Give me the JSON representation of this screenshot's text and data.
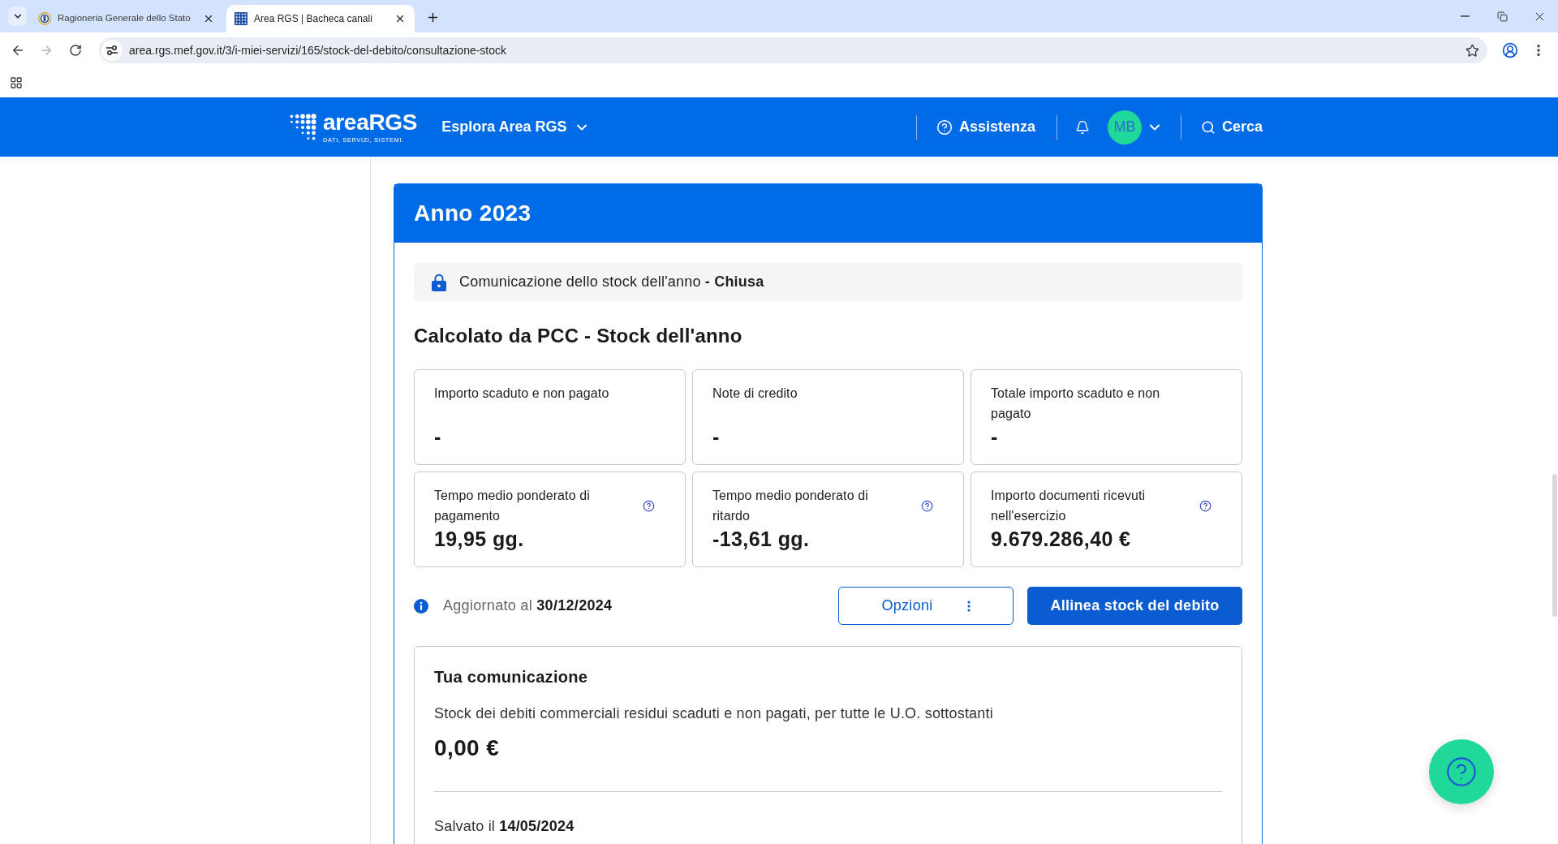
{
  "browser": {
    "tabs": [
      {
        "title": "Ragioneria Generale dello Stato",
        "selected": false
      },
      {
        "title": "Area RGS | Bacheca canali",
        "selected": true
      }
    ],
    "back_disabled": false,
    "forward_disabled": true,
    "url": "area.rgs.mef.gov.it/3/i-miei-servizi/165/stock-del-debito/consultazione-stock"
  },
  "header": {
    "brand": {
      "name": "areaRGS",
      "tagline": "DATI, SERVIZI, SISTEMI."
    },
    "menu": "Esplora Area RGS",
    "help": "Assistenza",
    "user": {
      "initials": "MB"
    },
    "search": "Cerca"
  },
  "card": {
    "title": "Anno 2023",
    "status": "Comunicazione dello stock dell'anno **- Chiusa**",
    "section_title": "Calcolato da PCC - Stock dell'anno",
    "stats": [
      {
        "label": "Importo scaduto e non pagato",
        "value": "-",
        "help": false
      },
      {
        "label": "Note di credito",
        "value": "-",
        "help": false
      },
      {
        "label": "Totale importo scaduto e non pagato",
        "value": "-",
        "help": false
      },
      {
        "label": "Tempo medio ponderato di pagamento",
        "value": "19,95 gg.",
        "help": true
      },
      {
        "label": "Tempo medio ponderato di ritardo",
        "value": "-13,61 gg.",
        "help": true
      },
      {
        "label": "Importo documenti ricevuti nell'esercizio",
        "value": "9.679.286,40 €",
        "help": true
      }
    ],
    "updated": "Aggiornato al **30/12/2024**",
    "buttons": [
      {
        "kind": "outline",
        "label": "Opzioni"
      },
      {
        "kind": "primary",
        "label": "Allinea stock del debito"
      }
    ],
    "communication": {
      "title": "Tua comunicazione",
      "description": "Stock dei debiti commerciali residui scaduti e non pagati, per tutte le U.O. sottostanti",
      "amount": "0,00 €",
      "saved": "Salvato il **14/05/2024**"
    }
  }
}
